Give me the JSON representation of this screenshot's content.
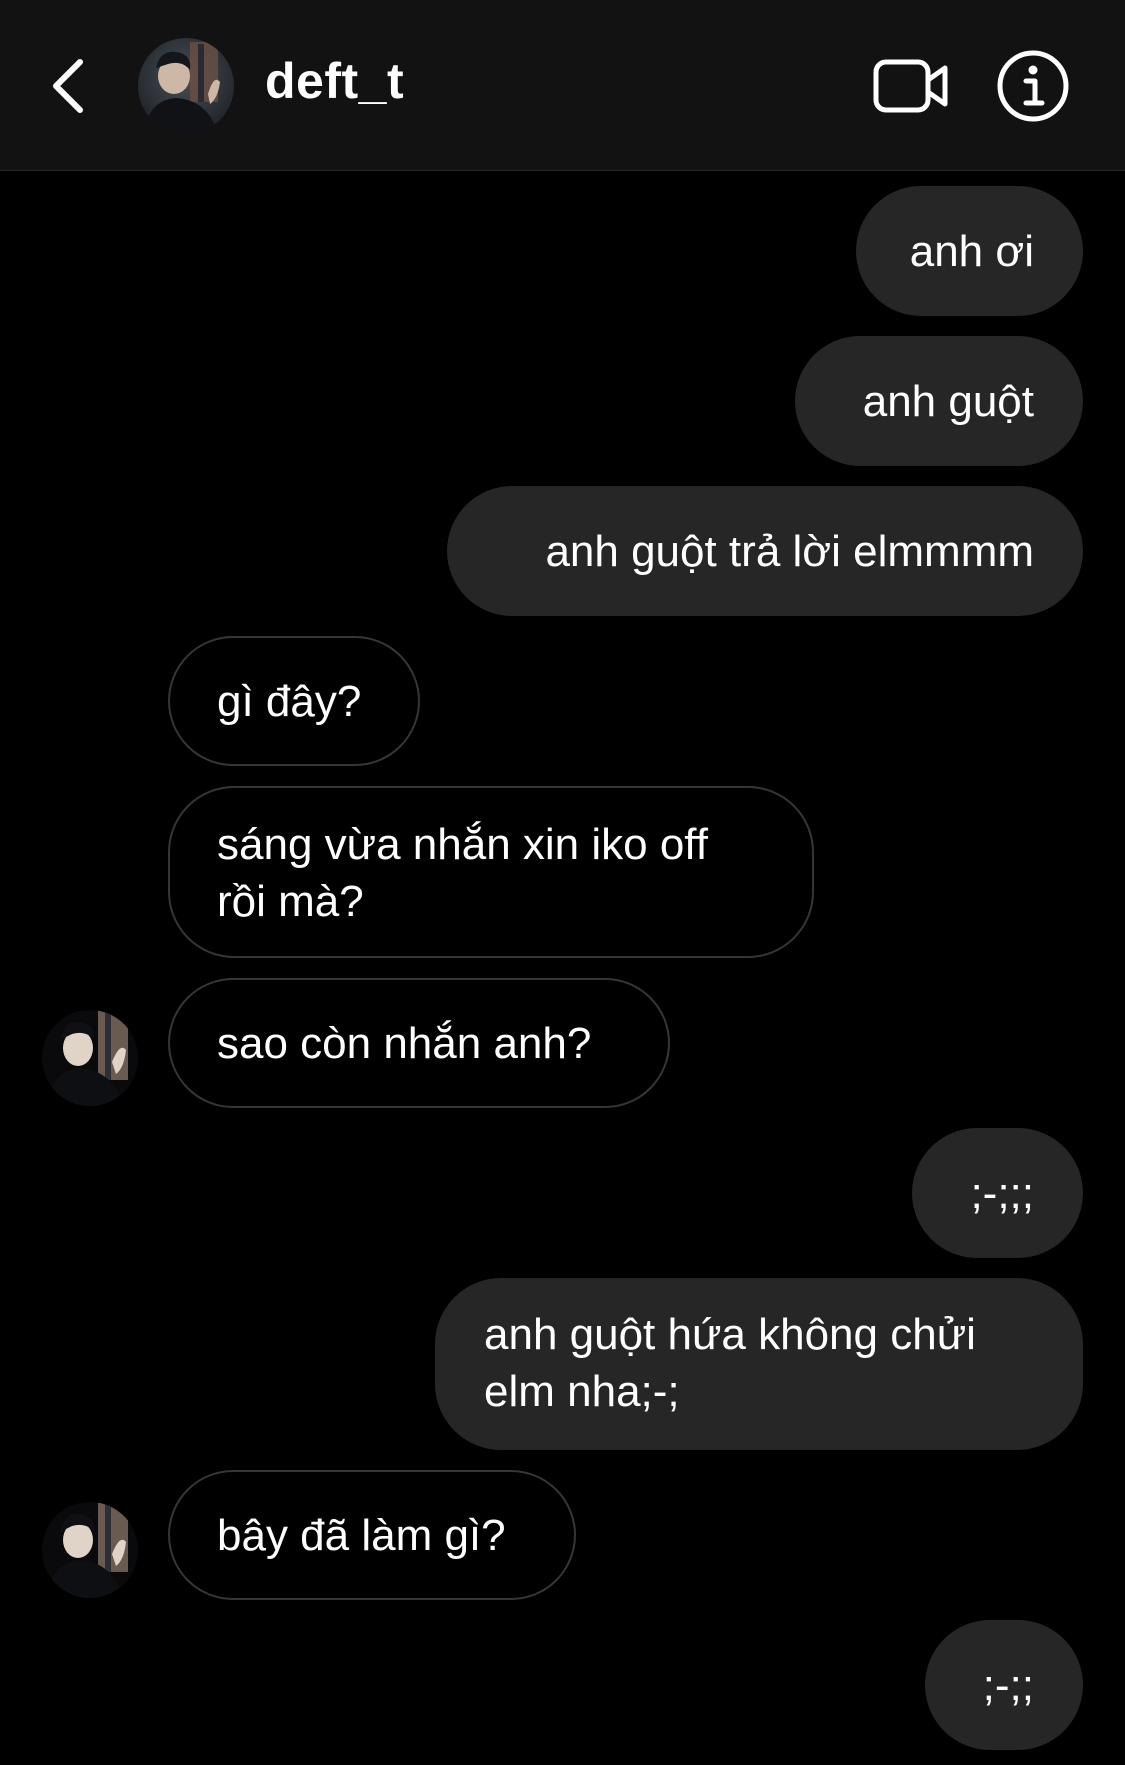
{
  "header": {
    "username": "deft_t",
    "back_icon": "chevron-left-icon",
    "video_icon": "video-camera-icon",
    "info_icon": "info-icon"
  },
  "colors": {
    "background": "#000000",
    "header_bg": "#121212",
    "sent_bubble": "#262626",
    "received_border": "#363636",
    "text": "#ffffff"
  },
  "messages": [
    {
      "side": "sent",
      "text": "anh ơi"
    },
    {
      "side": "sent",
      "text": "anh guột"
    },
    {
      "side": "sent",
      "text": "anh guột trả lời elmmmm"
    },
    {
      "side": "received",
      "text": "gì đây?"
    },
    {
      "side": "received",
      "text": "sáng vừa nhắn xin iko off rồi mà?"
    },
    {
      "side": "received",
      "text": "sao còn nhắn anh?"
    },
    {
      "side": "sent",
      "text": ";-;;;"
    },
    {
      "side": "sent",
      "text": "anh guột hứa không chửi elm nha;-;"
    },
    {
      "side": "received",
      "text": "bây đã làm gì?"
    },
    {
      "side": "sent",
      "text": ";-;;"
    }
  ]
}
